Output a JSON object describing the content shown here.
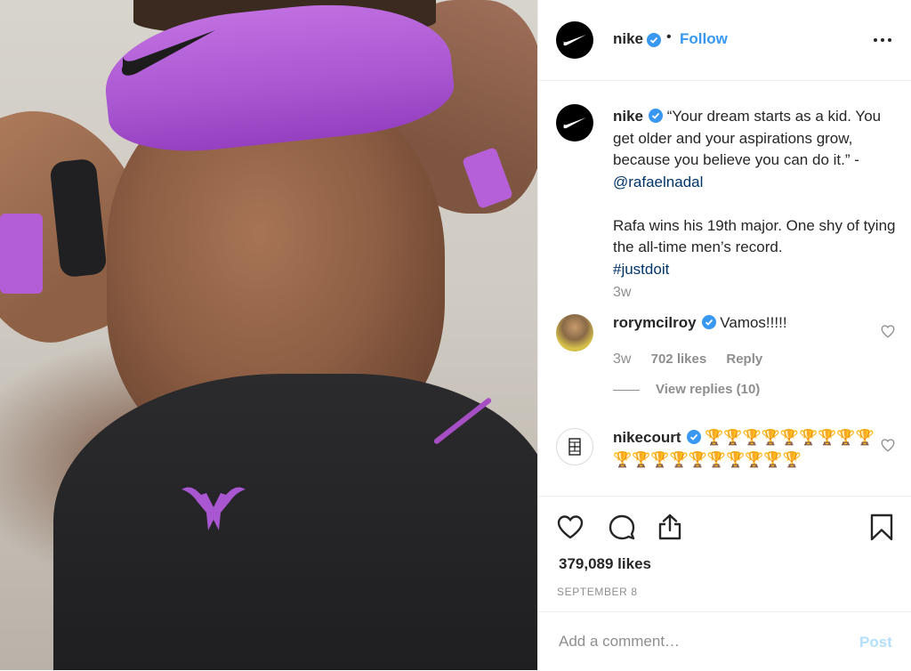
{
  "post": {
    "photo_description_icon": "nike-swoosh-icon",
    "accent_color": "#a956d1"
  },
  "header": {
    "username": "nike",
    "separator": "•",
    "follow_label": "Follow"
  },
  "caption": {
    "username": "nike",
    "quote": "“Your dream starts as a kid. You get older and your aspirations grow, because you believe you can do it.” -",
    "mention": "@rafaelnadal",
    "body": "Rafa wins his 19th major. One shy of tying the all-time men’s record.",
    "hashtag": "#justdoit",
    "time": "3w"
  },
  "comments": [
    {
      "username": "rorymcilroy",
      "text": "Vamos!!!!!",
      "time": "3w",
      "likes": "702 likes",
      "reply_label": "Reply",
      "view_replies": "View replies (10)"
    },
    {
      "username": "nikecourt",
      "text": "🏆🏆🏆🏆🏆🏆🏆🏆🏆🏆🏆🏆🏆🏆🏆🏆🏆🏆🏆"
    }
  ],
  "stats": {
    "likes": "379,089 likes",
    "date": "SEPTEMBER 8"
  },
  "composer": {
    "placeholder": "Add a comment…",
    "post_label": "Post"
  },
  "colors": {
    "link": "#003569",
    "follow": "#3897f0",
    "verified": "#3897f0",
    "muted": "#8e8e8e",
    "post_disabled": "#b2dffc"
  }
}
